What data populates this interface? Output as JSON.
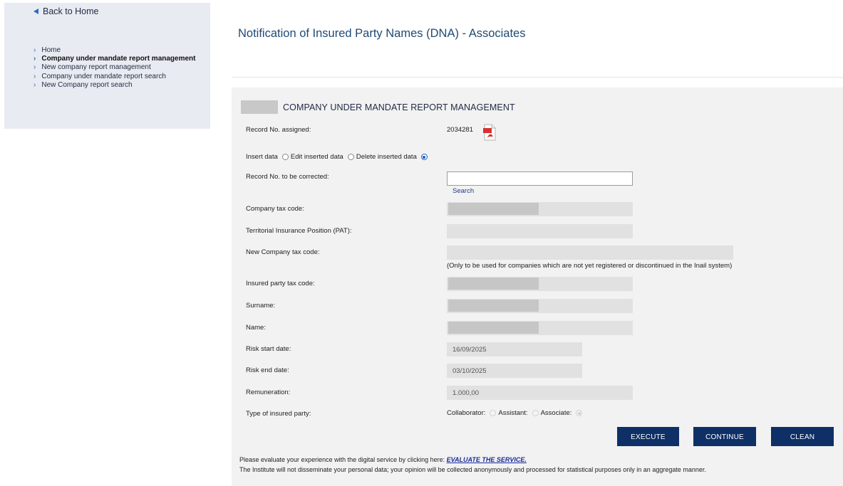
{
  "sidebar": {
    "back_label": "Back to Home",
    "items": [
      {
        "label": "Home"
      },
      {
        "label": "Company under mandate report management"
      },
      {
        "label": "New company report management"
      },
      {
        "label": "Company under mandate report search"
      },
      {
        "label": "New Company report search"
      }
    ],
    "active_index": 1
  },
  "page": {
    "title": "Notification of Insured Party Names (DNA) - Associates"
  },
  "form": {
    "section_title": "COMPANY UNDER MANDATE REPORT MANAGEMENT",
    "record_no_label": "Record No. assigned:",
    "record_no_value": "2034281",
    "mode_options": [
      {
        "label": "Insert data",
        "checked": false
      },
      {
        "label": "Edit inserted data",
        "checked": false
      },
      {
        "label": "Delete inserted data",
        "checked": true
      }
    ],
    "record_to_correct_label": "Record No. to be corrected:",
    "record_to_correct_value": "",
    "search_label": "Search",
    "company_tax_code_label": "Company tax code:",
    "pat_label": "Territorial Insurance Position (PAT):",
    "new_company_tax_code_label": "New Company tax code:",
    "new_company_note": "(Only to be used for companies which are not yet registered or discontinued in the Inail system)",
    "insured_tax_code_label": "Insured party tax code:",
    "surname_label": "Surname:",
    "name_label": "Name:",
    "risk_start_label": "Risk start date:",
    "risk_start_value": "16/09/2025",
    "risk_end_label": "Risk end date:",
    "risk_end_value": "03/10/2025",
    "remuneration_label": "Remuneration:",
    "remuneration_value": "1.000,00",
    "type_label": "Type of insured party:",
    "type_options": [
      {
        "label": "Collaborator:",
        "checked": false
      },
      {
        "label": "Assistant:",
        "checked": false
      },
      {
        "label": "Associate:",
        "checked": true
      }
    ]
  },
  "buttons": {
    "execute": "EXECUTE",
    "continue": "CONTINUE",
    "clean": "CLEAN"
  },
  "footer": {
    "survey_text": "Please evaluate your experience with the digital service by clicking here: ",
    "survey_link": "EVALUATE THE SERVICE.",
    "privacy_text": "The Institute will not disseminate your personal data; your opinion will be collected anonymously and processed for statistical purposes only in an aggregate manner."
  },
  "colors": {
    "sidebar_bg": "#e8ebf1",
    "panel_bg": "#f2f2f2",
    "button_bg": "#0e3066",
    "accent": "#2b6cc4",
    "title": "#1f4a75"
  },
  "icons": {
    "back": "back-arrow-icon",
    "nav": "chevron-right-icon",
    "record": "pdf-icon"
  }
}
